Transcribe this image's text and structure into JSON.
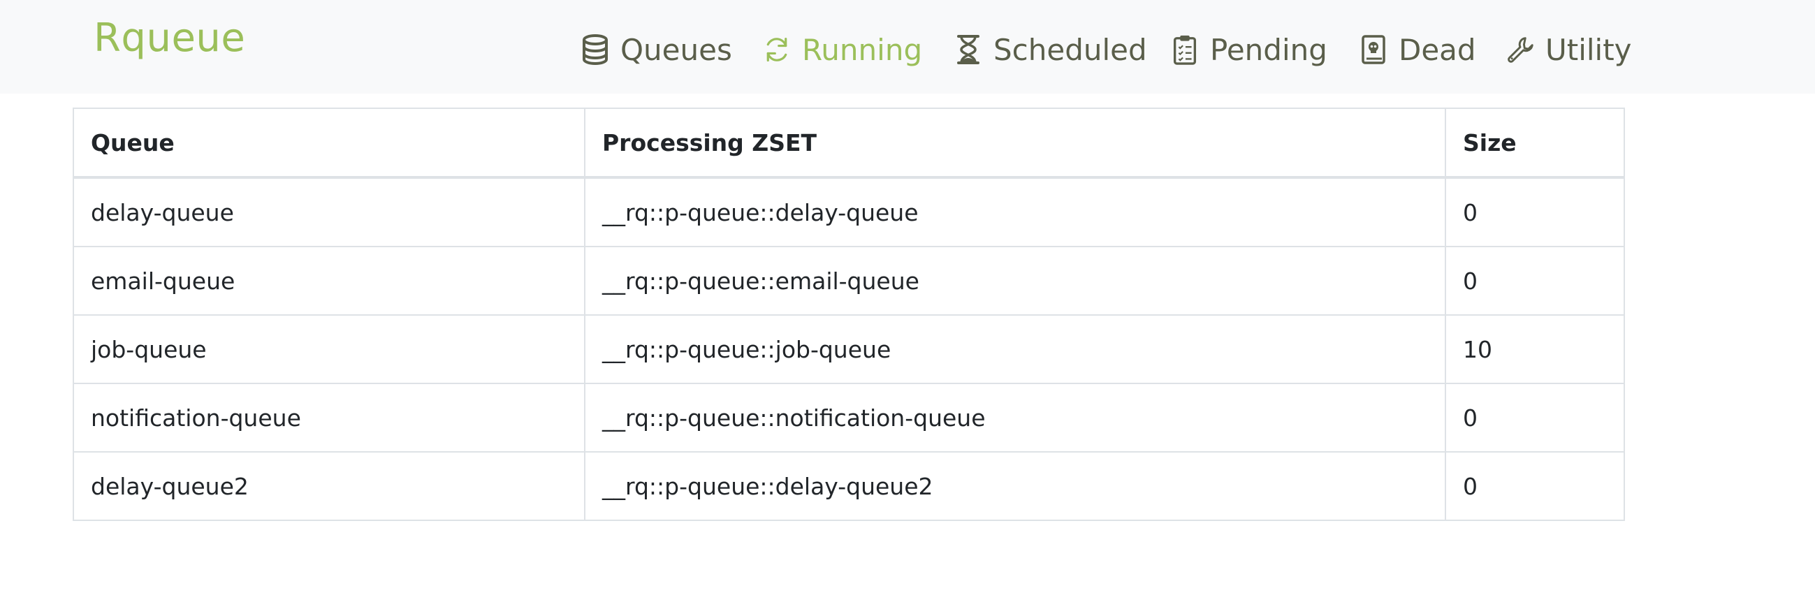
{
  "brand": {
    "name": "Rqueue"
  },
  "nav": {
    "items": [
      {
        "label": "Queues",
        "icon": "database-icon",
        "active": false
      },
      {
        "label": "Running",
        "icon": "sync-icon",
        "active": true
      },
      {
        "label": "Scheduled",
        "icon": "hourglass-icon",
        "active": false
      },
      {
        "label": "Pending",
        "icon": "clipboard-list-icon",
        "active": false
      },
      {
        "label": "Dead",
        "icon": "skull-book-icon",
        "active": false
      },
      {
        "label": "Utility",
        "icon": "wrench-icon",
        "active": false
      }
    ]
  },
  "colors": {
    "accent": "#9bbf5a",
    "nav_text": "#5a5e4a",
    "navbar_bg": "#f8f9fa"
  },
  "table": {
    "headers": [
      "Queue",
      "Processing ZSET",
      "Size"
    ],
    "rows": [
      [
        "delay-queue",
        "__rq::p-queue::delay-queue",
        "0"
      ],
      [
        "email-queue",
        "__rq::p-queue::email-queue",
        "0"
      ],
      [
        "job-queue",
        "__rq::p-queue::job-queue",
        "10"
      ],
      [
        "notification-queue",
        "__rq::p-queue::notification-queue",
        "0"
      ],
      [
        "delay-queue2",
        "__rq::p-queue::delay-queue2",
        "0"
      ]
    ]
  }
}
